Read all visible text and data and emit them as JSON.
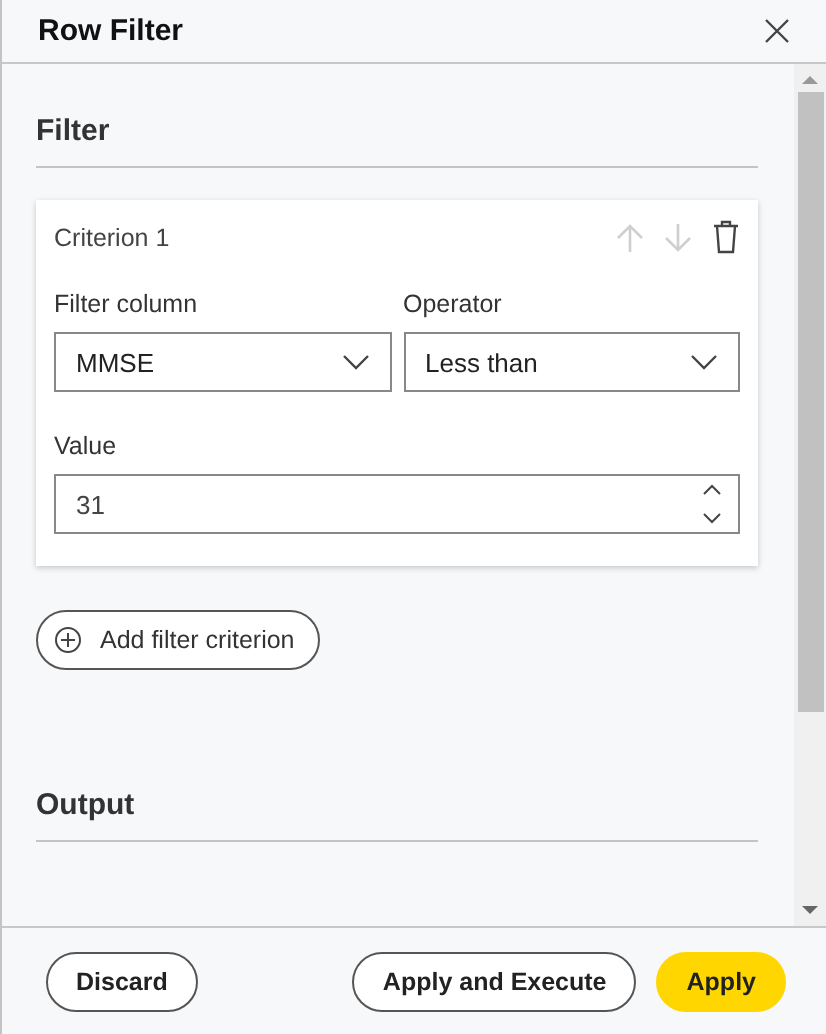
{
  "window": {
    "title": "Row Filter"
  },
  "sections": [
    {
      "title": "Filter"
    },
    {
      "title": "Output"
    }
  ],
  "criteria": [
    {
      "title": "Criterion 1",
      "move_up_disabled": true,
      "move_down_disabled": true,
      "filter_column": {
        "label": "Filter column",
        "value": "MMSE"
      },
      "operator": {
        "label": "Operator",
        "value": "Less than"
      },
      "value": {
        "label": "Value",
        "value": "31"
      }
    }
  ],
  "add_button": "Add filter criterion",
  "footer": {
    "buttons": [
      {
        "label": "Discard",
        "kind": "outline"
      },
      {
        "label": "Apply and Execute",
        "kind": "outline"
      },
      {
        "label": "Apply",
        "kind": "primary"
      }
    ]
  }
}
